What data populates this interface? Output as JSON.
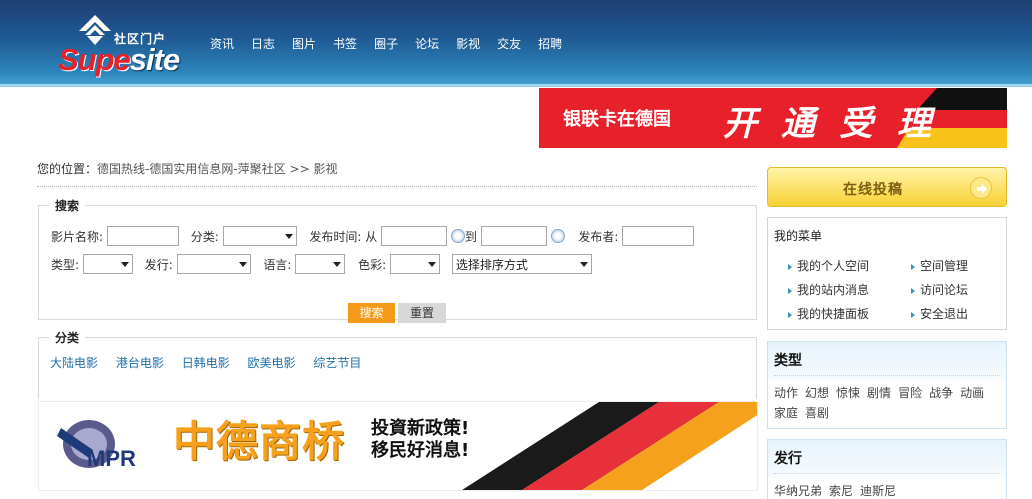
{
  "header": {
    "logo_cn": "社区门户",
    "logo_en_a": "Supe",
    "logo_en_b": "site",
    "nav": [
      "资讯",
      "日志",
      "图片",
      "书签",
      "圈子",
      "论坛",
      "影视",
      "交友",
      "招聘"
    ]
  },
  "top_banner": {
    "text_left": "银联卡在德国",
    "text_right": "开通受理"
  },
  "breadcrumb": {
    "prefix": "您的位置：",
    "site": "德国热线-德国实用信息网-萍聚社区",
    "sep": ">>",
    "current": "影视"
  },
  "search": {
    "legend": "搜索",
    "name_label": "影片名称:",
    "category_label": "分类:",
    "date_label": "发布时间: 从",
    "date_to": "到",
    "publisher_label": "发布者:",
    "type_label": "类型:",
    "release_label": "发行:",
    "language_label": "语言:",
    "color_label": "色彩:",
    "sort_select": "选择排序方式",
    "search_button": "搜索",
    "reset_button": "重置"
  },
  "categories": {
    "legend": "分类",
    "items": [
      "大陆电影",
      "港台电影",
      "日韩电影",
      "欧美电影",
      "综艺节目"
    ]
  },
  "mid_banner": {
    "logo": "MPR",
    "headline": "中德商桥",
    "line1": "投資新政策!",
    "line2": "移民好消息!"
  },
  "sidebar": {
    "submit_label": "在线投稿",
    "menu_title": "我的菜单",
    "menu_items": [
      "我的个人空间",
      "空间管理",
      "我的站内消息",
      "访问论坛",
      "我的快捷面板",
      "安全退出"
    ],
    "type_title": "类型",
    "type_tags": [
      "动作",
      "幻想",
      "惊悚",
      "剧情",
      "冒险",
      "战争",
      "动画",
      "家庭",
      "喜剧"
    ],
    "release_title": "发行",
    "release_tags": [
      "华纳兄弟",
      "索尼",
      "迪斯尼"
    ]
  },
  "colors": {
    "header_blue": "#1f5a94",
    "accent_orange": "#f49a1a",
    "link_blue": "#1f6fa9",
    "banner_red": "#e8202a"
  }
}
